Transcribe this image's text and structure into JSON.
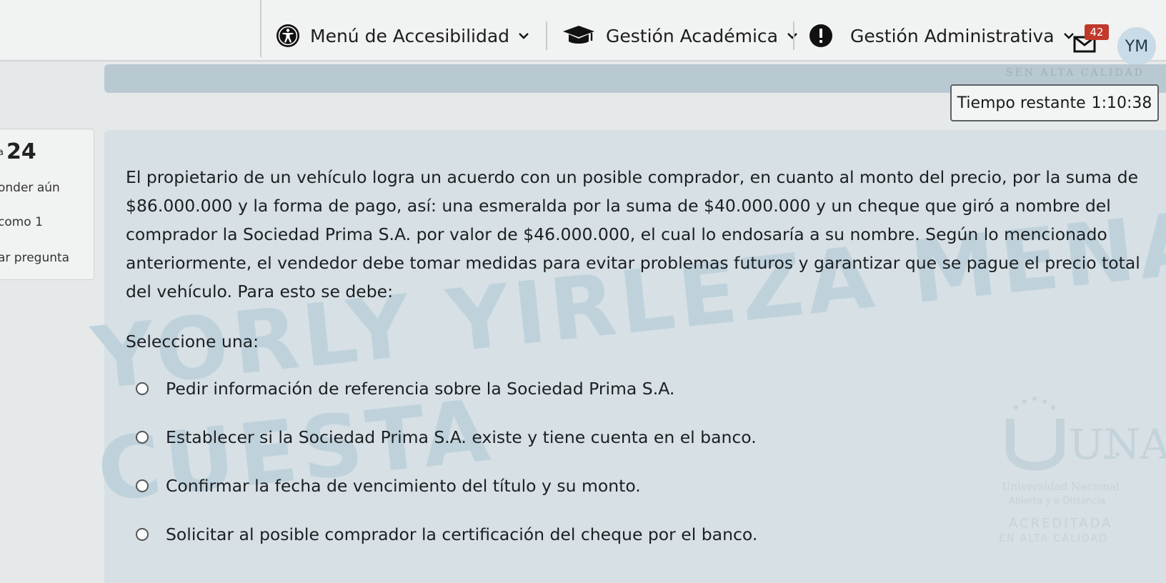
{
  "navbar": {
    "accessibility_menu": "Menú de Accesibilidad",
    "academic_menu": "Gestión Académica",
    "admin_menu": "Gestión Administrativa",
    "messages_badge": "42",
    "avatar_initials": "YM"
  },
  "banner": {
    "faint_text": "SEN ALTA CALIDAD"
  },
  "timer": {
    "label": "Tiempo restante",
    "value": "1:10:38"
  },
  "question_info": {
    "prefix": "a",
    "number": "24",
    "status": "onder aún",
    "points": "como 1",
    "flag": "ar pregunta"
  },
  "question": {
    "text": "El propietario de un vehículo logra un acuerdo con un posible comprador, en cuanto al monto del precio, por la suma de $86.000.000 y la forma de pago, así: una esmeralda por la suma de $40.000.000 y un cheque que giró a nombre del comprador la Sociedad Prima S.A. por valor de $46.000.000, el cual lo endosaría a su nombre. Según lo mencionado anteriormente, el vendedor debe tomar medidas para evitar problemas futuros y garantizar que se pague el precio total del vehículo. Para esto se debe:",
    "prompt": "Seleccione una:",
    "options": [
      "Pedir información de referencia sobre la Sociedad Prima S.A.",
      "Establecer si la Sociedad Prima S.A. existe y tiene cuenta en el banco.",
      "Confirmar la fecha de vencimiento del título y su monto.",
      "Solicitar al posible comprador la certificación del cheque por el banco."
    ]
  },
  "watermark": {
    "line1": "YORLY YIRLEZA MENA",
    "line2": "CUESTA"
  },
  "logo": {
    "letters": "UNAD",
    "subtitle": "Universidad Nacional",
    "subtitle2": "Abierta y a Distancia",
    "accreditation": "ACREDITADA",
    "accreditation2": "EN ALTA CALIDAD"
  },
  "colors": {
    "badge": "#c0392b",
    "panel": "#d6e0e5",
    "banner": "#b9c9d2"
  }
}
